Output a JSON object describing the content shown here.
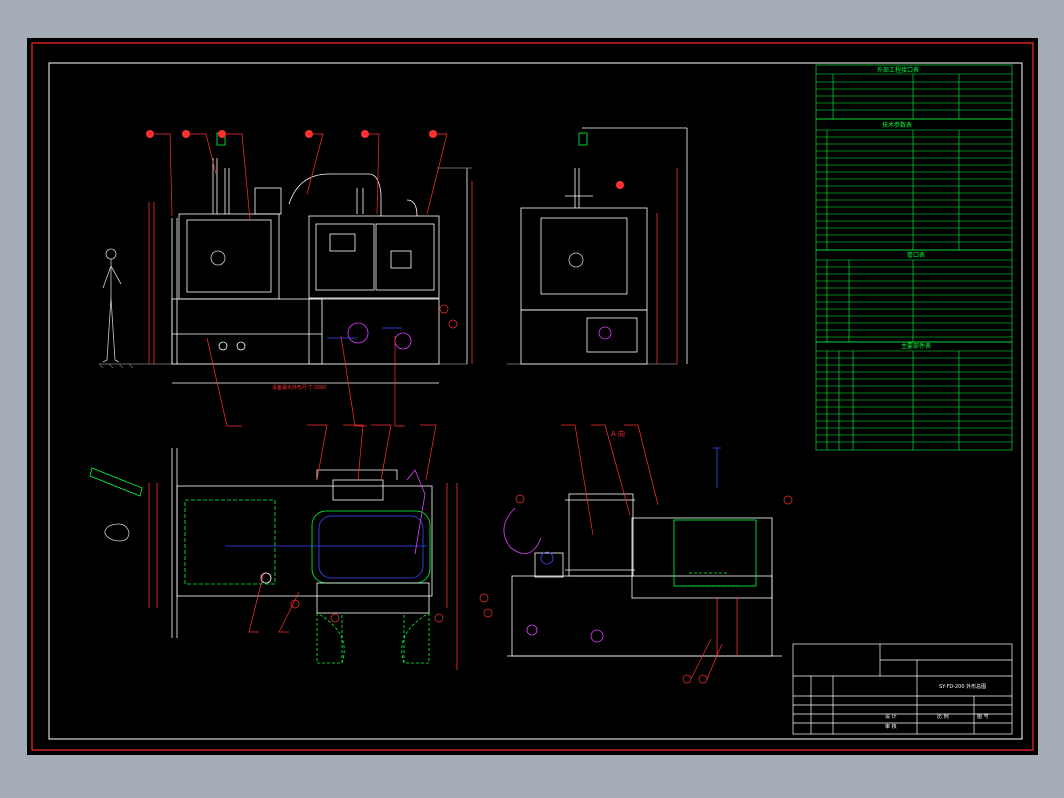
{
  "drawing": {
    "background_color": "#000000",
    "outer_frame_color": "#ff2a2a",
    "line_white": "#ffffff",
    "line_green": "#00ff3c",
    "line_red": "#ff3030",
    "line_blue": "#3a4cff",
    "line_magenta": "#e040ff",
    "line_cyan": "#00e5ff"
  },
  "views": {
    "plan_view_title": "A 向"
  },
  "tables": {
    "utility_title": "外部工程接口表",
    "params_title": "技术参数表",
    "pipe_title": "管口表",
    "parts_title": "主要部件表",
    "utility_rows": 6,
    "params_rows": 17,
    "pipe_rows": 12,
    "parts_rows": 16
  },
  "title_block": {
    "drawing_name": "SY-FD-200 外形总图",
    "fields": [
      "设 计",
      "审 核",
      "比 例",
      "图 号"
    ]
  }
}
